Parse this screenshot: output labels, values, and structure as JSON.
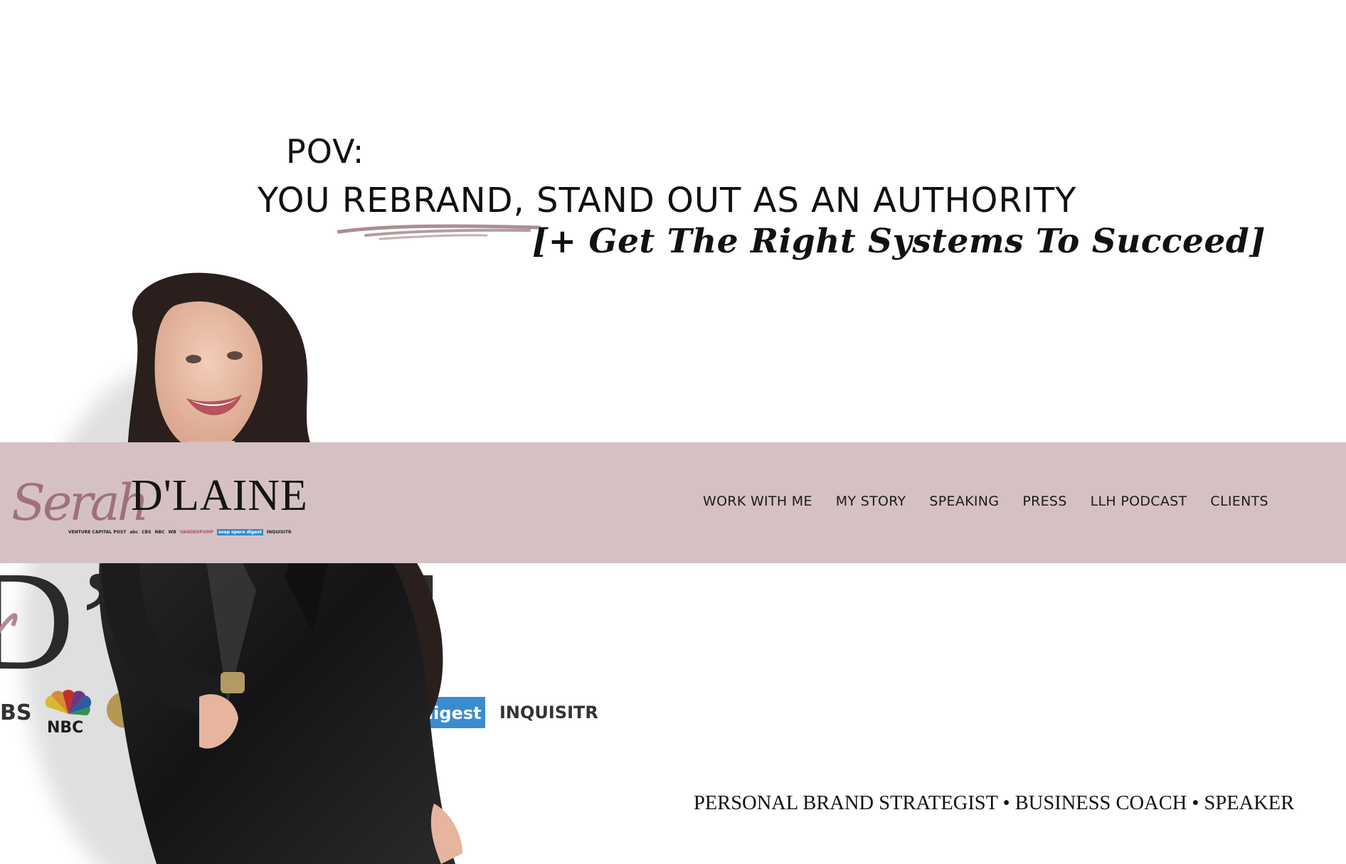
{
  "hero": {
    "pov_label": "POV:",
    "headline": "YOU REBRAND, STAND OUT AS AN AUTHORITY",
    "subheadline": "[+ Get The Right Systems To Succeed]",
    "background_logo_fragment": "D'LINE",
    "press_logos": [
      "BS",
      "NBC",
      "digest",
      "INQUISITR"
    ]
  },
  "nav": {
    "logo": {
      "script_text": "Serah",
      "main_text": "D'LAINE",
      "badges": [
        "VENTURE CAPITAL POST",
        "abc",
        "CBS",
        "NBC",
        "WB",
        "VANDERPUMP",
        "soap opera digest",
        "INQUISITR"
      ]
    },
    "items": [
      {
        "label": "WORK WITH ME"
      },
      {
        "label": "MY STORY"
      },
      {
        "label": "SPEAKING"
      },
      {
        "label": "PRESS"
      },
      {
        "label": "LLH PODCAST"
      },
      {
        "label": "CLIENTS"
      }
    ]
  },
  "tagline": "PERSONAL BRAND STRATEGIST • BUSINESS COACH • SPEAKER",
  "colors": {
    "nav_background": "#d5c1c3",
    "accent_mauve": "#9b6b74",
    "text": "#111111"
  }
}
